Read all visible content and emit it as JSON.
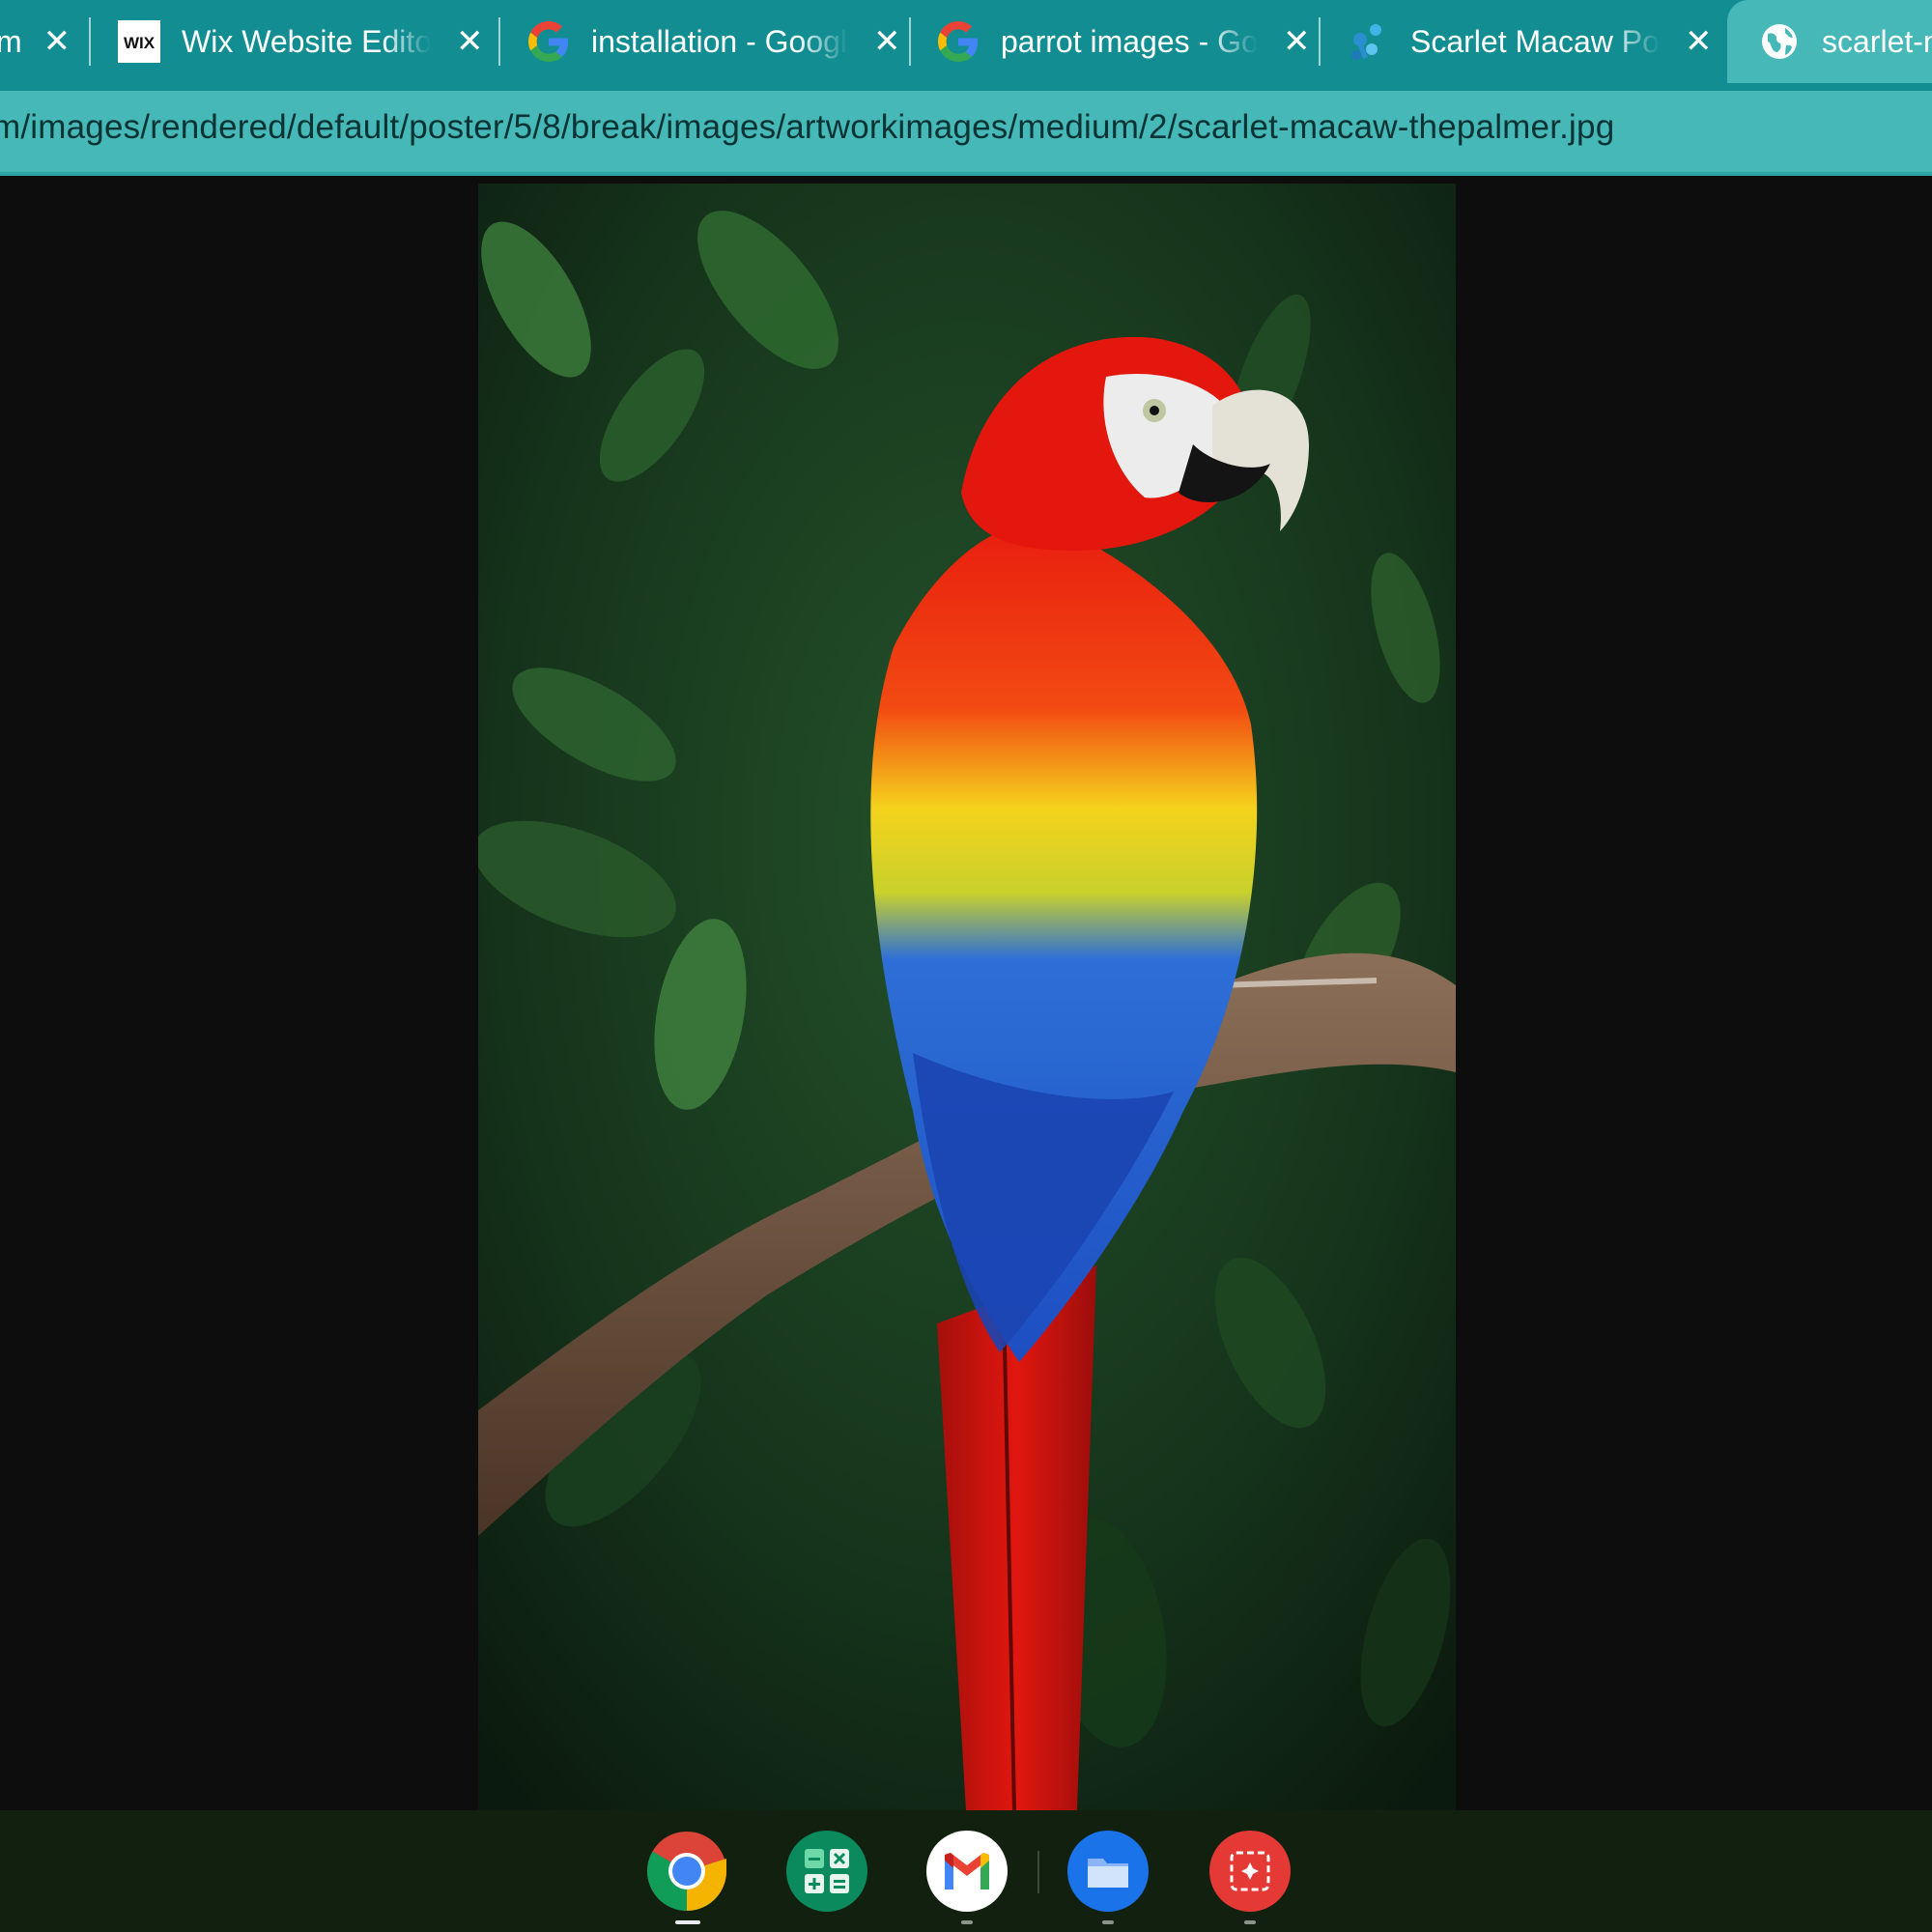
{
  "browser": {
    "tabs": [
      {
        "title": "m",
        "favicon": "generic",
        "active": false
      },
      {
        "title": "Wix Website Editor",
        "favicon": "wix-logo",
        "active": false
      },
      {
        "title": "installation - Google",
        "favicon": "google-g",
        "active": false
      },
      {
        "title": "parrot images - Google",
        "favicon": "google-g",
        "active": false
      },
      {
        "title": "Scarlet Macaw Poster",
        "favicon": "fineart-logo",
        "active": false
      },
      {
        "title": "scarlet-macaw-thepalmer.jpg",
        "favicon": "globe",
        "active": true
      }
    ],
    "wix_favicon_text": "WIX",
    "close_glyph": "✕",
    "url": "m/images/rendered/default/poster/5/8/break/images/artworkimages/medium/2/scarlet-macaw-thepalmer.jpg"
  },
  "viewer": {
    "image_subject": "scarlet macaw parrot on branch",
    "background_color": "#0d0d0d"
  },
  "shelf": {
    "apps": [
      {
        "name": "Chrome",
        "icon": "chrome-icon",
        "running": true,
        "focused": true
      },
      {
        "name": "Calculator",
        "icon": "calculator-icon",
        "running": false,
        "focused": false
      },
      {
        "name": "Gmail",
        "icon": "gmail-icon",
        "running": true,
        "focused": false
      },
      {
        "name": "Files",
        "icon": "files-icon",
        "running": true,
        "focused": false
      },
      {
        "name": "Screencast",
        "icon": "screencast-icon",
        "running": true,
        "focused": false
      }
    ]
  },
  "colors": {
    "tabstrip": "#128e92",
    "active_tab": "#46b8b8",
    "shelf": "#11200f"
  }
}
